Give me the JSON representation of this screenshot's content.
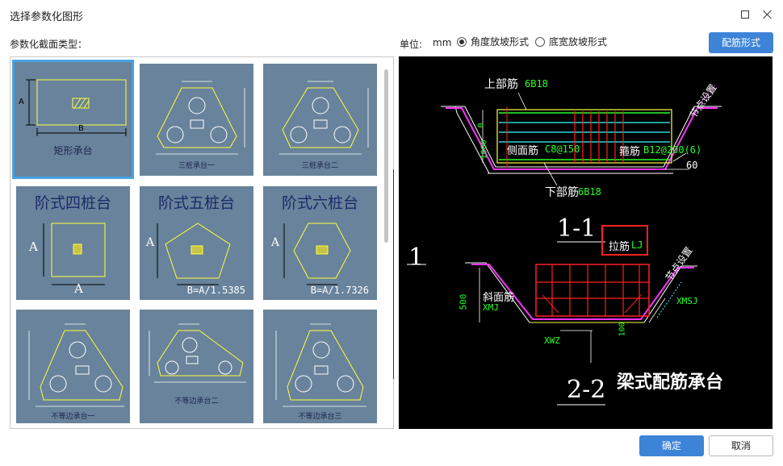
{
  "window": {
    "title": "选择参数化图形",
    "maximize_icon": "maximize-icon",
    "close_icon": "close-icon"
  },
  "gallery": {
    "label": "参数化截面类型：",
    "tiles": [
      {
        "label": "矩形承台",
        "side_a": "A",
        "side_b": "B"
      },
      {
        "label": "三桩承台一"
      },
      {
        "label": "三桩承台二"
      },
      {
        "title": "阶式四桩台",
        "side_a": "A",
        "side_b": "A"
      },
      {
        "title": "阶式五桩台",
        "side_a": "A",
        "note": "B=A/1.5385"
      },
      {
        "title": "阶式六桩台",
        "side_a": "A",
        "note": "B=A/1.7326"
      },
      {
        "label": "不等边承台一"
      },
      {
        "label": "不等边承台二"
      },
      {
        "label": "不等边承台三"
      }
    ]
  },
  "options": {
    "units_label": "单位:",
    "units_value": "mm",
    "radio_angle": "角度放坡形式",
    "radio_width": "底宽放坡形式",
    "selected": "radio_angle",
    "rebar_button": "配筋形式"
  },
  "preview": {
    "top_bar": "上部筋",
    "top_bar_spec": "6B18",
    "side_bar": "侧面筋",
    "side_bar_spec": "C8@150",
    "stirrup": "箍筋",
    "stirrup_spec": "B12@200(6)",
    "bottom_bar": "下部筋",
    "bottom_bar_spec": "6B18",
    "node_setting_1": "节点设置",
    "node_setting_2": "节点设置",
    "angle": "60",
    "dim_0": "0",
    "dim_1000": "1000",
    "section_1": "1-1",
    "tie_bar": "拉筋",
    "tie_bar_spec": "LJ",
    "slope_bar": "斜面筋",
    "slope_bar_spec": "XMJ",
    "dim_500": "500",
    "dim_100": "100",
    "xmsj": "XMSJ",
    "xwz": "XWZ",
    "section_2": "2-2",
    "caption": "梁式配筋承台",
    "side_marker": "1"
  },
  "footer": {
    "ok": "确定",
    "cancel": "取消"
  },
  "colors": {
    "accent": "#3d84d9",
    "tile_bg": "#68839b",
    "selection": "#4aa2e3",
    "cad_bg": "#000000",
    "cad_green": "#27ff27",
    "cad_red": "#ff2020",
    "cad_magenta": "#ff33ff",
    "cad_cyan": "#33ffff",
    "cad_yellow": "#ffff44"
  }
}
